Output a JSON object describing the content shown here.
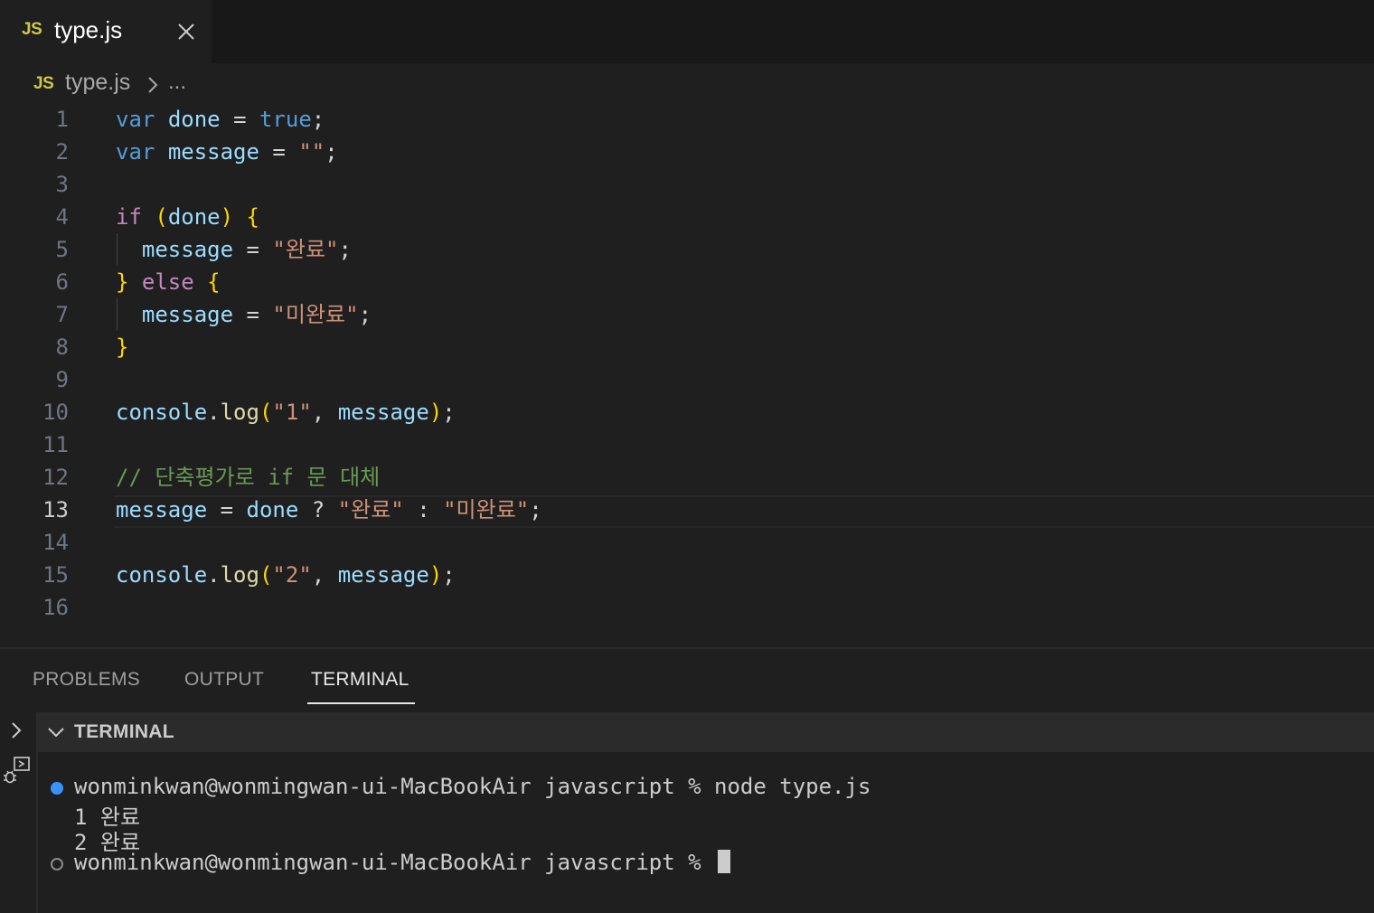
{
  "tab": {
    "badge": "JS",
    "title": "type.js",
    "close_icon": "close-icon"
  },
  "breadcrumb": {
    "badge": "JS",
    "file": "type.js",
    "more": "..."
  },
  "editor": {
    "active_line": 13,
    "line_numbers": [
      "1",
      "2",
      "3",
      "4",
      "5",
      "6",
      "7",
      "8",
      "9",
      "10",
      "11",
      "12",
      "13",
      "14",
      "15",
      "16"
    ],
    "code": {
      "l1": [
        "var",
        "done",
        "=",
        "true",
        ";"
      ],
      "l2": [
        "var",
        "message",
        "=",
        "\"\"",
        ";"
      ],
      "l4": [
        "if",
        "(",
        "done",
        ")",
        "{"
      ],
      "l5": [
        "message",
        "=",
        "\"완료\"",
        ";"
      ],
      "l6": [
        "}",
        "else",
        "{"
      ],
      "l7": [
        "message",
        "=",
        "\"미완료\"",
        ";"
      ],
      "l8": [
        "}"
      ],
      "l10": [
        "console",
        ".",
        "log",
        "(",
        "\"1\"",
        ",",
        "message",
        ")",
        ";"
      ],
      "l12": [
        "// 단축평가로 if 문 대체"
      ],
      "l13": [
        "message",
        "=",
        "done",
        "?",
        "\"완료\"",
        ":",
        "\"미완료\"",
        ";"
      ],
      "l15": [
        "console",
        ".",
        "log",
        "(",
        "\"2\"",
        ",",
        "message",
        ")",
        ";"
      ]
    }
  },
  "panel": {
    "tabs": [
      "PROBLEMS",
      "OUTPUT",
      "TERMINAL"
    ],
    "active_tab": "TERMINAL",
    "terminal_title": "TERMINAL"
  },
  "terminal": {
    "lines": [
      "wonminkwan@wonmingwan-ui-MacBookAir javascript % node type.js",
      "1 완료",
      "2 완료",
      "wonminkwan@wonmingwan-ui-MacBookAir javascript % "
    ]
  },
  "colors": {
    "editor_bg": "#1f1f1f",
    "keyword": "#569cd6",
    "control": "#c586c0",
    "variable": "#9cdcfe",
    "function": "#dcdcaa",
    "string": "#ce9178",
    "comment": "#6a9955",
    "bracket": "#ffd700",
    "js_badge": "#cbcb41",
    "status_dot": "#3794ff"
  }
}
